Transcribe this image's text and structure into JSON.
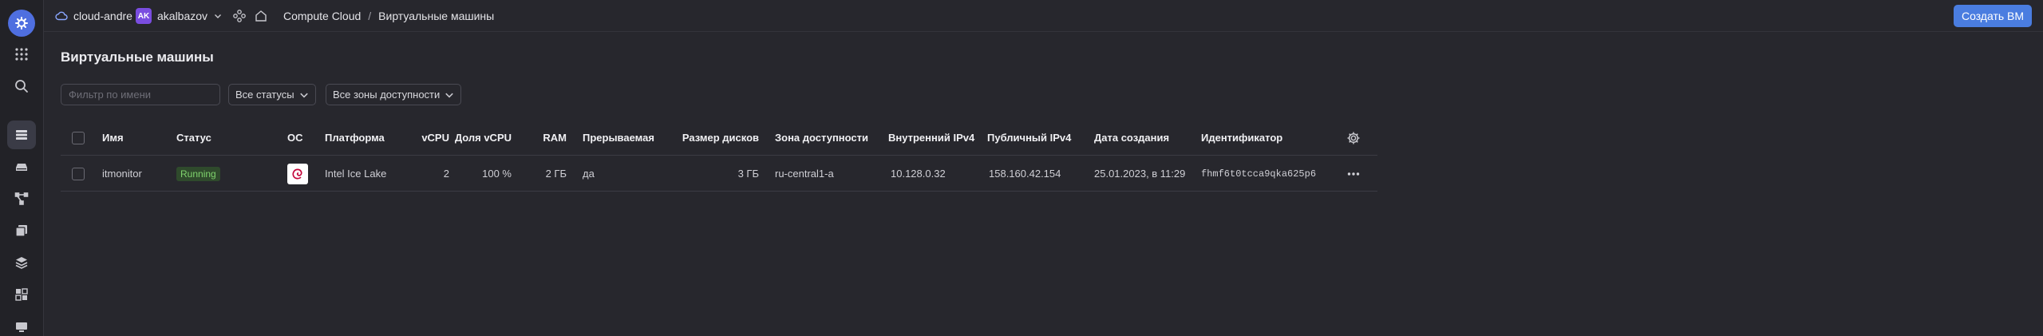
{
  "topbar": {
    "cloud_name": "cloud-andre",
    "user_initials": "AK",
    "user_name": "akalbazov",
    "breadcrumb": [
      "Compute Cloud",
      "Виртуальные машины"
    ],
    "breadcrumb_sep": "/",
    "create_button": "Создать ВМ"
  },
  "page": {
    "title": "Виртуальные машины",
    "filter_placeholder": "Фильтр по имени",
    "status_filter": "Все статусы",
    "zone_filter": "Все зоны доступности"
  },
  "table": {
    "columns": [
      "Имя",
      "Статус",
      "ОС",
      "Платформа",
      "vCPU",
      "Доля vCPU",
      "RAM",
      "Прерываемая",
      "Размер дисков",
      "Зона доступности",
      "Внутренний IPv4",
      "Публичный IPv4",
      "Дата создания",
      "Идентификатор"
    ],
    "rows": [
      {
        "name": "itmonitor",
        "status": "Running",
        "os_icon": "debian-icon",
        "platform": "Intel Ice Lake",
        "vcpu": "2",
        "vcpu_share": "100 %",
        "ram": "2 ГБ",
        "preemptible": "да",
        "disk_size": "3 ГБ",
        "zone": "ru-central1-a",
        "internal_ipv4": "10.128.0.32",
        "public_ipv4": "158.160.42.154",
        "created": "25.01.2023, в 11:29",
        "id": "fhmf6t0tcca9qka625p6"
      }
    ]
  },
  "colors": {
    "background": "#27272d",
    "rail": "#222227",
    "accent": "#4a7de0",
    "status_running": "#7fd36d"
  }
}
